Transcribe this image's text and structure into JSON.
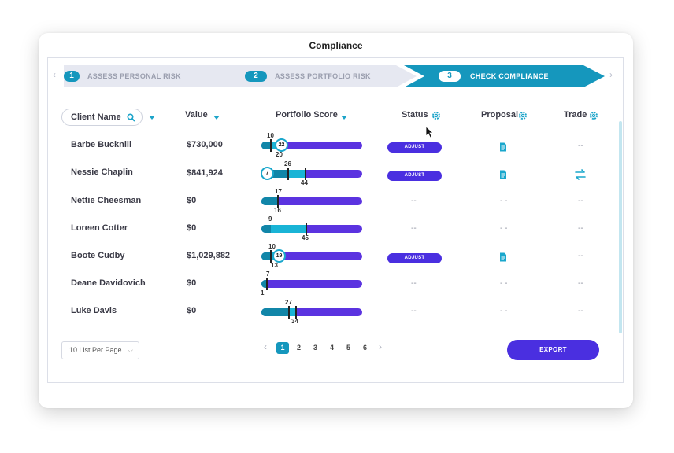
{
  "window": {
    "title": "Compliance"
  },
  "stepper": {
    "steps": [
      {
        "number": "1",
        "label": "ASSESS PERSONAL RISK",
        "state": "done"
      },
      {
        "number": "2",
        "label": "ASSESS PORTFOLIO RISK",
        "state": "done"
      },
      {
        "number": "3",
        "label": "CHECK COMPLIANCE",
        "state": "active"
      }
    ],
    "prev_icon": "chevron-left-icon",
    "next_icon": "chevron-right-icon"
  },
  "table": {
    "headers": {
      "client_name": "Client Name",
      "value": "Value",
      "portfolio_score": "Portfolio Score",
      "status": "Status",
      "proposal": "Proposal",
      "trade": "Trade"
    },
    "rows": [
      {
        "name": "Barbe Bucknill",
        "value": "$730,000",
        "score": {
          "low": "10",
          "high": "20",
          "bubble": "22"
        },
        "status": "ADJUST",
        "proposal": "doc",
        "trade": "--"
      },
      {
        "name": "Nessie Chaplin",
        "value": "$841,924",
        "score": {
          "low": "26",
          "high": "44",
          "bubble": "7"
        },
        "status": "ADJUST",
        "proposal": "doc",
        "trade": "swap"
      },
      {
        "name": "Nettie Cheesman",
        "value": "$0",
        "score": {
          "low": "17",
          "high": "16"
        },
        "status": "--",
        "proposal": "- -",
        "trade": "--"
      },
      {
        "name": "Loreen Cotter",
        "value": "$0",
        "score": {
          "low": "9",
          "high": "45"
        },
        "status": "--",
        "proposal": "- -",
        "trade": "--"
      },
      {
        "name": "Boote Cudby",
        "value": "$1,029,882",
        "score": {
          "low": "10",
          "high": "13",
          "bubble": "19"
        },
        "status": "ADJUST",
        "proposal": "doc",
        "trade": "--"
      },
      {
        "name": "Deane Davidovich",
        "value": "$0",
        "score": {
          "low": "7",
          "high": "1"
        },
        "status": "--",
        "proposal": "- -",
        "trade": "--"
      },
      {
        "name": "Luke Davis",
        "value": "$0",
        "score": {
          "low": "27",
          "high": "34"
        },
        "status": "--",
        "proposal": "- -",
        "trade": "--"
      }
    ]
  },
  "footer": {
    "per_page": "10 List Per Page",
    "pages": [
      "1",
      "2",
      "3",
      "4",
      "5",
      "6"
    ],
    "current_page": "1",
    "export_label": "EXPORT"
  },
  "colors": {
    "accent": "#1597bd",
    "primary": "#4a2fe0",
    "track": "#5b33e0",
    "fill": "#19b4d6"
  }
}
